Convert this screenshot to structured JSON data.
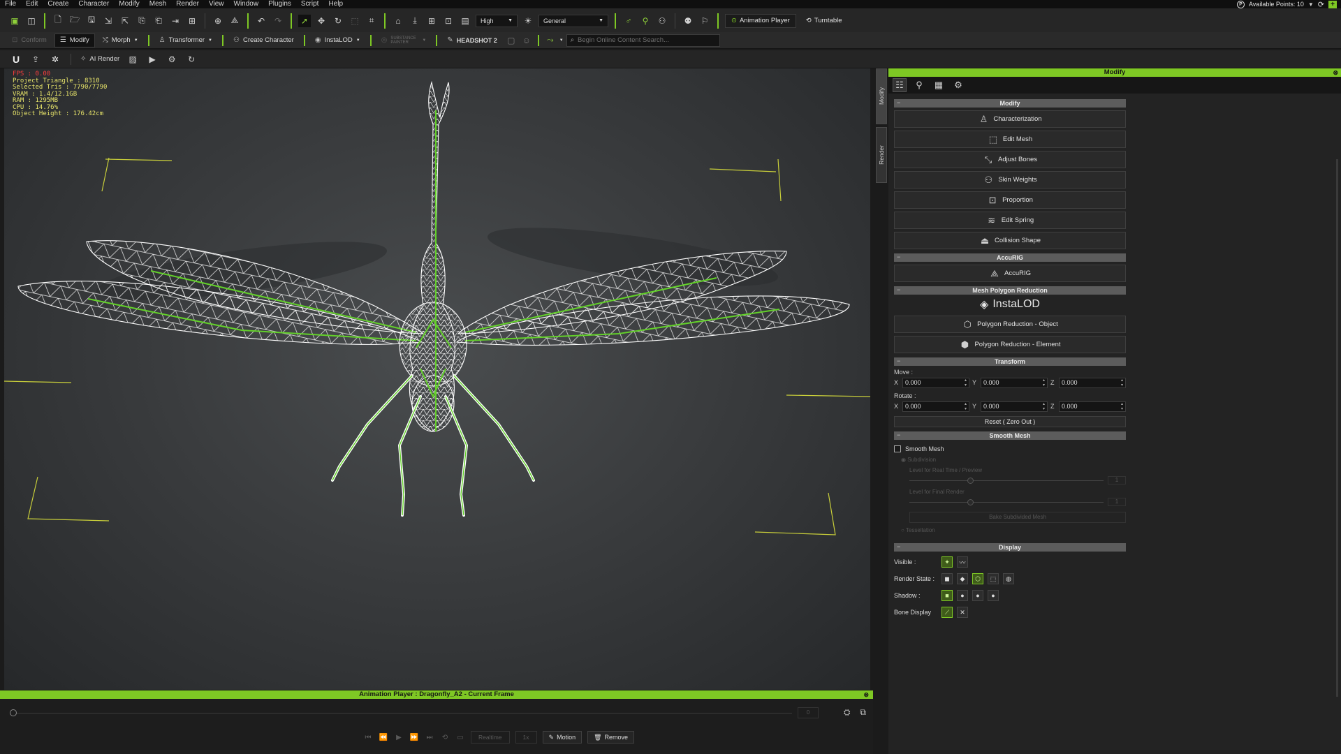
{
  "menu": [
    "File",
    "Edit",
    "Create",
    "Character",
    "Modify",
    "Mesh",
    "Render",
    "View",
    "Window",
    "Plugins",
    "Script",
    "Help"
  ],
  "status": {
    "available_points": "Available Points: 10"
  },
  "toolbar1": {
    "quality": "High",
    "preset": "General",
    "animation_player": "Animation Player",
    "turntable": "Turntable"
  },
  "toolbar2": {
    "conform": "Conform",
    "modify": "Modify",
    "morph": "Morph",
    "transformer": "Transformer",
    "create_character": "Create Character",
    "instalod": "InstaLOD",
    "substance": "SUBSTANCE PAINTER",
    "headshot": "HEADSHOT 2",
    "search_placeholder": "Begin Online Content Search..."
  },
  "toolbar3": {
    "ai_render": "AI Render"
  },
  "stats": {
    "fps": "FPS : 0.00",
    "project_triangle": "Project Triangle : 8310",
    "selected_tris": "Selected Tris : 7790/7790",
    "vram": "VRAM : 1.4/12.1GB",
    "ram": "RAM : 1295MB",
    "cpu": "CPU : 14.76%",
    "object_height": "Object Height : 176.42cm"
  },
  "side_tabs": [
    "Modify",
    "Render"
  ],
  "panel": {
    "title": "Modify",
    "sections": {
      "modify": "Modify",
      "accurig": "AccuRIG",
      "mesh_reduction": "Mesh Polygon Reduction",
      "transform": "Transform",
      "smooth_mesh": "Smooth Mesh",
      "display": "Display"
    },
    "modify_buttons": [
      {
        "label": "Characterization",
        "icon": "characterization-icon"
      },
      {
        "label": "Edit Mesh",
        "icon": "edit-mesh-icon"
      },
      {
        "label": "Adjust Bones",
        "icon": "adjust-bones-icon"
      },
      {
        "label": "Skin Weights",
        "icon": "skin-weights-icon"
      },
      {
        "label": "Proportion",
        "icon": "proportion-icon"
      },
      {
        "label": "Edit Spring",
        "icon": "edit-spring-icon"
      },
      {
        "label": "Collision Shape",
        "icon": "collision-shape-icon"
      }
    ],
    "accurig_button": "AccuRIG",
    "instalod_logo": "InstaLOD",
    "reduce_object": "Polygon Reduction - Object",
    "reduce_element": "Polygon Reduction - Element",
    "move_label": "Move :",
    "rotate_label": "Rotate :",
    "move": {
      "x": "0.000",
      "y": "0.000",
      "z": "0.000"
    },
    "rotate": {
      "x": "0.000",
      "y": "0.000",
      "z": "0.000"
    },
    "reset": "Reset ( Zero Out )",
    "smooth_mesh_check": "Smooth Mesh",
    "subdivision": "Subdivision",
    "level_realtime": "Level for Real Time / Preview",
    "level_final": "Level for Final Render",
    "level_realtime_value": "1",
    "level_final_value": "1",
    "bake_subdivided": "Bake Subdivided Mesh",
    "tessellation": "Tessellation",
    "visible": "Visible :",
    "render_state": "Render State :",
    "shadow": "Shadow :",
    "bone_display": "Bone Display"
  },
  "anim": {
    "title": "Animation Player : Dragonfly_A2 - Current Frame",
    "frame": "0",
    "realtime": "Realtime",
    "speed": "1x",
    "motion": "Motion",
    "remove": "Remove"
  },
  "colors": {
    "accent": "#7ec824",
    "wire": "#ffffff",
    "bone": "#63d12a",
    "stats": "#e8e56a",
    "fps": "#ff3d3d"
  }
}
